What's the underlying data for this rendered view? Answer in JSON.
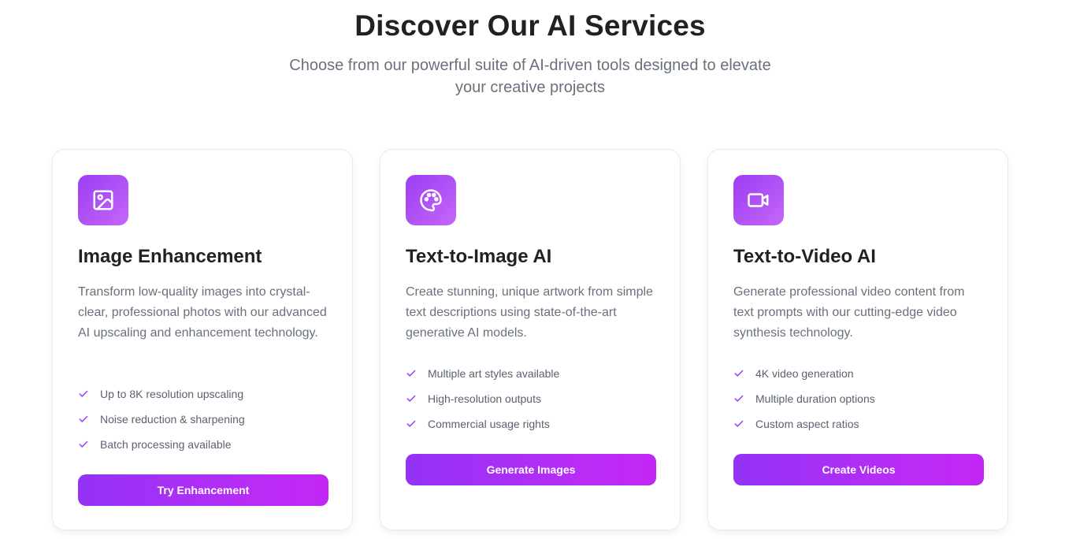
{
  "header": {
    "title": "Discover Our AI Services",
    "subtitle_line1": "Choose from our powerful suite of AI-driven tools designed to elevate",
    "subtitle_line2": "your creative projects"
  },
  "colors": {
    "accent": "#9c3cf5",
    "accent_light": "#c567f8",
    "button_start": "#9333f5",
    "button_end": "#c326f5",
    "check": "#9c3cf5"
  },
  "cards": [
    {
      "icon": "image-icon",
      "title": "Image Enhancement",
      "description": "Transform low-quality images into crystal-clear, professional photos with our advanced AI upscaling and enhancement technology.",
      "features": [
        "Up to 8K resolution upscaling",
        "Noise reduction & sharpening",
        "Batch processing available"
      ],
      "button": "Try Enhancement"
    },
    {
      "icon": "palette-icon",
      "title": "Text-to-Image AI",
      "description": "Create stunning, unique artwork from simple text descriptions using state-of-the-art generative AI models.",
      "features": [
        "Multiple art styles available",
        "High-resolution outputs",
        "Commercial usage rights"
      ],
      "button": "Generate Images"
    },
    {
      "icon": "video-camera-icon",
      "title": "Text-to-Video AI",
      "description": "Generate professional video content from text prompts with our cutting-edge video synthesis technology.",
      "features": [
        "4K video generation",
        "Multiple duration options",
        "Custom aspect ratios"
      ],
      "button": "Create Videos"
    }
  ]
}
